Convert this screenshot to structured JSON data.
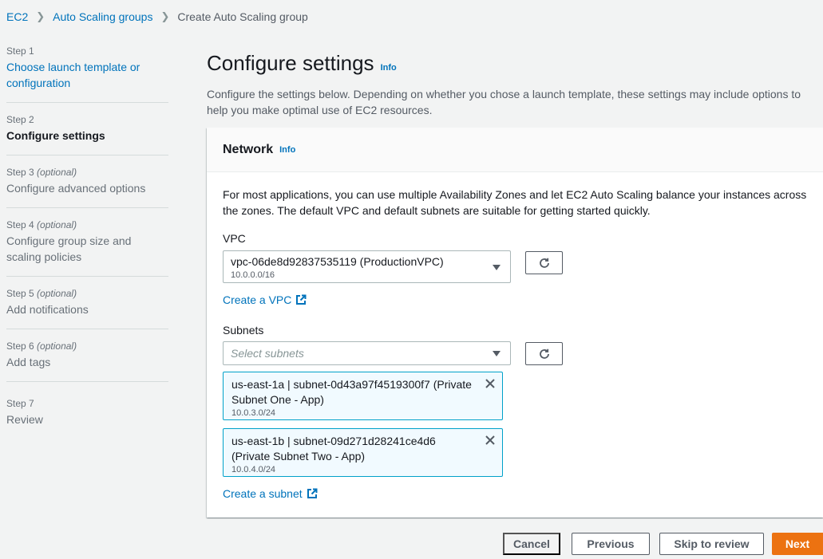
{
  "breadcrumb": {
    "items": [
      "EC2",
      "Auto Scaling groups",
      "Create Auto Scaling group"
    ]
  },
  "steps": [
    {
      "num": "Step 1",
      "optional": "",
      "title": "Choose launch template or configuration"
    },
    {
      "num": "Step 2",
      "optional": "",
      "title": "Configure settings"
    },
    {
      "num": "Step 3",
      "optional": "(optional)",
      "title": "Configure advanced options"
    },
    {
      "num": "Step 4",
      "optional": "(optional)",
      "title": "Configure group size and scaling policies"
    },
    {
      "num": "Step 5",
      "optional": "(optional)",
      "title": "Add notifications"
    },
    {
      "num": "Step 6",
      "optional": "(optional)",
      "title": "Add tags"
    },
    {
      "num": "Step 7",
      "optional": "",
      "title": "Review"
    }
  ],
  "page": {
    "title": "Configure settings",
    "info": "Info",
    "description": "Configure the settings below. Depending on whether you chose a launch template, these settings may include options to help you make optimal use of EC2 resources."
  },
  "network": {
    "title": "Network",
    "info": "Info",
    "description": "For most applications, you can use multiple Availability Zones and let EC2 Auto Scaling balance your instances across the zones. The default VPC and default subnets are suitable for getting started quickly.",
    "vpc_label": "VPC",
    "vpc_value": "vpc-06de8d92837535119 (ProductionVPC)",
    "vpc_cidr": "10.0.0.0/16",
    "create_vpc": "Create a VPC",
    "subnets_label": "Subnets",
    "subnets_placeholder": "Select subnets",
    "selected_subnets": [
      {
        "text": "us-east-1a | subnet-0d43a97f4519300f7 (Private Subnet One - App)",
        "cidr": "10.0.3.0/24"
      },
      {
        "text": "us-east-1b | subnet-09d271d28241ce4d6 (Private Subnet Two - App)",
        "cidr": "10.0.4.0/24"
      }
    ],
    "create_subnet": "Create a subnet"
  },
  "footer": {
    "cancel": "Cancel",
    "previous": "Previous",
    "skip": "Skip to review",
    "next": "Next"
  },
  "colors": {
    "link": "#0073bb",
    "primary_button": "#ec7211",
    "token_bg": "#f1faff",
    "token_border": "#00a1c9"
  },
  "icons": [
    "chevron-right-icon",
    "refresh-icon",
    "caret-down-icon",
    "external-link-icon",
    "close-icon"
  ]
}
